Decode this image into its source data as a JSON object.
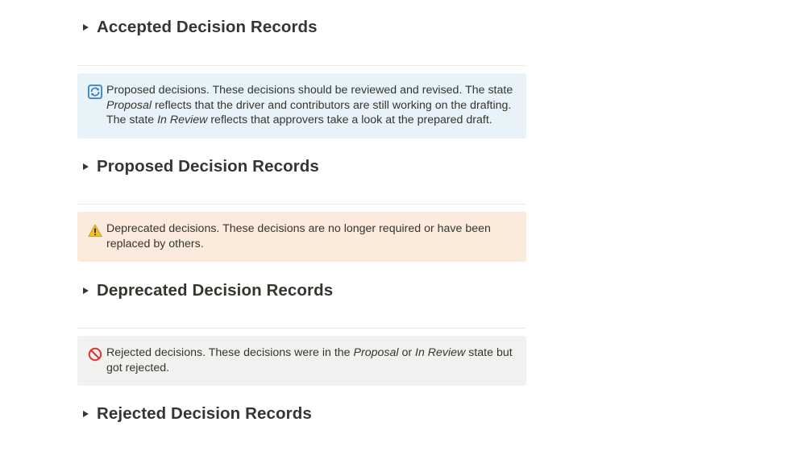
{
  "sections": {
    "accepted": {
      "title": "Accepted Decision Records"
    },
    "proposed": {
      "title": "Proposed Decision Records"
    },
    "deprecated": {
      "title": "Deprecated Decision Records"
    },
    "rejected": {
      "title": "Rejected Decision Records"
    }
  },
  "callouts": {
    "proposed": {
      "icon": "refresh-icon",
      "bg": "#e7f3f8",
      "t1": "Proposed decisions. These decisions should be reviewed and revised. The state ",
      "i1": "Proposal",
      "t2": " reflects that the driver and contributors are still working on the drafting. The state ",
      "i2": "In Review",
      "t3": " reflects that approvers take a look at the prepared draft."
    },
    "deprecated": {
      "icon": "warning-icon",
      "bg": "#faebdd",
      "t1": "Deprecated decisions. These decisions are no longer required or have been replaced by others."
    },
    "rejected": {
      "icon": "prohibited-icon",
      "bg": "#f1f1ef",
      "t1": "Rejected decisions. These decisions were in the ",
      "i1": "Proposal",
      "t2": " or ",
      "i2": "In Review",
      "t3": " state but got rejected."
    }
  },
  "toggle_glyph": "▶"
}
